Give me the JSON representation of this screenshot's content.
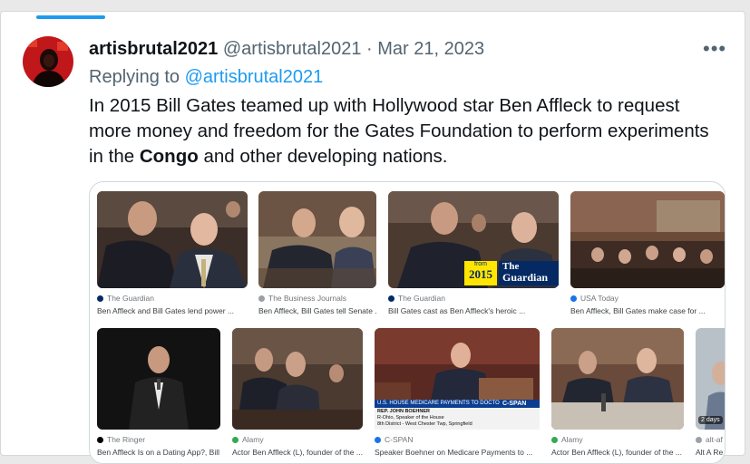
{
  "tweet": {
    "display_name": "artisbrutal2021",
    "handle": "@artisbrutal2021",
    "separator": "·",
    "date": "Mar 21, 2023",
    "more_label": "•••",
    "replying_prefix": "Replying to",
    "replying_handle": "@artisbrutal2021",
    "text_before": "In 2015 Bill Gates teamed up with Hollywood star Ben Affleck to request more money and freedom for the Gates Foundation to perform experiments in the ",
    "text_bold": "Congo",
    "text_after": " and other developing nations."
  },
  "results": {
    "row1": [
      {
        "source": "The Guardian",
        "caption": "Ben Affleck and Bill Gates lend power ...",
        "icon": "guardian-logo-icon"
      },
      {
        "source": "The Business Journals",
        "caption": "Ben Affleck, Bill Gates tell Senate ...",
        "icon": "bizjournals-logo-icon"
      },
      {
        "source": "The Guardian",
        "caption": "Bill Gates cast as Ben Affleck's heroic ...",
        "icon": "guardian-logo-icon"
      },
      {
        "source": "USA Today",
        "caption": "Ben Affleck, Bill Gates make case for ...",
        "icon": "usatoday-logo-icon"
      }
    ],
    "row2": [
      {
        "source": "The Ringer",
        "caption": "Ben Affleck Is on a Dating App?, Bill ...",
        "icon": "ringer-logo-icon"
      },
      {
        "source": "Alamy",
        "caption": "Actor Ben Affleck (L), founder of the ...",
        "icon": "alamy-logo-icon"
      },
      {
        "source": "C-SPAN",
        "caption": "Speaker Boehner on Medicare Payments to ...",
        "icon": "cspan-logo-icon"
      },
      {
        "source": "Alamy",
        "caption": "Actor Ben Affleck (L), founder of the ...",
        "icon": "alamy-logo-icon"
      },
      {
        "source": "alt-af",
        "caption": "Alt A Re",
        "icon": "alt-logo-icon"
      }
    ]
  },
  "overlays": {
    "guardian_year_from": "from",
    "guardian_year": "2015",
    "guardian_brand_1": "The",
    "guardian_brand_2": "Guardian",
    "cspan_headline": "U.S. HOUSE MEDICARE PAYMENTS TO DOCTORS",
    "cspan_name": "REP. JOHN BOEHNER",
    "cspan_title": "R-Ohio, Speaker of the House",
    "cspan_loc": "8th District - West Chester Twp, Springfield",
    "cspan_logo": "C-SPAN",
    "days_badge": "2 days"
  },
  "colors": {
    "accent": "#1d9bf0",
    "text": "#0f1419",
    "muted": "#536471",
    "guardian_blue": "#052962",
    "guardian_yellow": "#ffe500"
  }
}
